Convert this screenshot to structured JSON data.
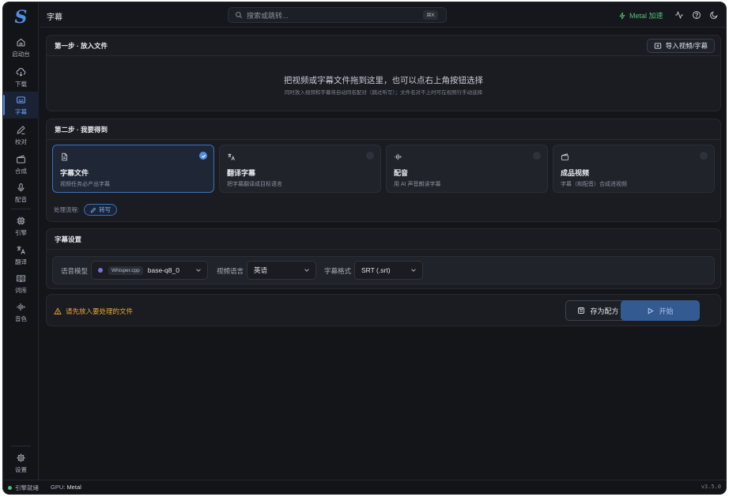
{
  "app": {
    "logo": "S"
  },
  "sidebar": {
    "items": [
      {
        "label": "启动台",
        "icon": "home-icon"
      },
      {
        "label": "下载",
        "icon": "download-cloud-icon"
      },
      {
        "label": "字幕",
        "icon": "subtitles-icon",
        "active": true
      },
      {
        "label": "校对",
        "icon": "pen-icon"
      },
      {
        "label": "合成",
        "icon": "film-icon"
      },
      {
        "label": "配音",
        "icon": "microphone-icon"
      },
      {
        "label": "引擎",
        "icon": "chip-icon"
      },
      {
        "label": "翻译",
        "icon": "translate-icon"
      },
      {
        "label": "词库",
        "icon": "book-icon"
      },
      {
        "label": "音色",
        "icon": "waveform-icon"
      }
    ],
    "settings_label": "设置"
  },
  "topbar": {
    "title": "字幕",
    "search_placeholder": "搜索或跳转...",
    "search_shortcut": "⌘K",
    "metal_label": "Metal 加速"
  },
  "step1": {
    "title": "第一步 · 放入文件",
    "import_button": "导入视频/字幕",
    "drop_title": "把视频或字幕文件拖到这里，也可以点右上角按钮选择",
    "drop_subtitle": "同时放入视频和字幕将自动同名配对（跳过听写）；文件名对不上时可在视频行手动选择"
  },
  "step2": {
    "title": "第二步 · 我要得到",
    "outputs": [
      {
        "title": "字幕文件",
        "desc": "视频任务必产出字幕",
        "icon": "document-icon",
        "selected": true
      },
      {
        "title": "翻译字幕",
        "desc": "把字幕翻译成目标语言",
        "icon": "translate-icon",
        "selected": false
      },
      {
        "title": "配音",
        "desc": "用 AI 声音朗读字幕",
        "icon": "waveform-icon",
        "selected": false
      },
      {
        "title": "成品视频",
        "desc": "字幕（和配音）合成进视频",
        "icon": "film-icon",
        "selected": false
      }
    ],
    "flow_label": "处理流程:",
    "flow_step": "转写"
  },
  "subtitle_settings": {
    "title": "字幕设置",
    "model_label": "语音模型",
    "model_engine": "Whisper.cpp",
    "model_value": "base-q8_0",
    "language_label": "视频语言",
    "language_value": "英语",
    "format_label": "字幕格式",
    "format_value": "SRT (.srt)"
  },
  "actions": {
    "warning": "请先放入要处理的文件",
    "save_label": "存为配方",
    "start_label": "开始"
  },
  "status": {
    "engine": "引擎就绪",
    "gpu_label": "GPU:",
    "gpu_value": "Metal",
    "version": "v3.5.0"
  },
  "colors": {
    "accent": "#4f8fe8",
    "warning": "#e8a63a",
    "success": "#49c27a",
    "metal": "#56c07a"
  }
}
